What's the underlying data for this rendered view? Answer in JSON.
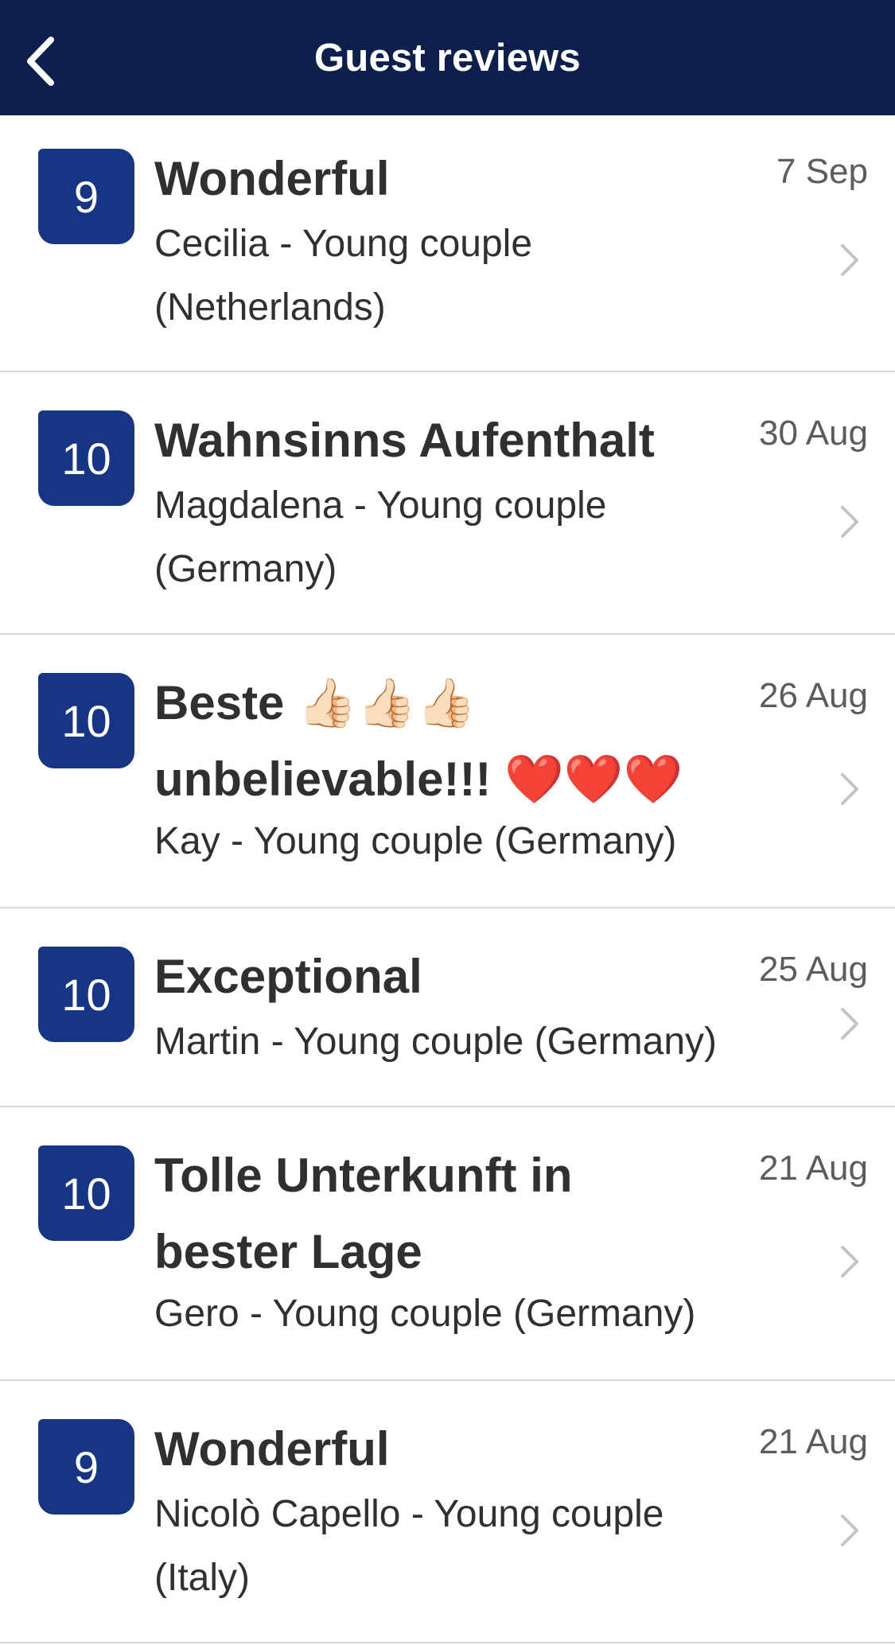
{
  "header": {
    "title": "Guest reviews",
    "back_icon": "chevron-left-icon"
  },
  "colors": {
    "header_bg": "#0c1f4d",
    "score_bg": "#173585",
    "divider": "#d7d7d7",
    "chevron": "#c4c4c7"
  },
  "reviews": [
    {
      "score": "9",
      "title": "Wonderful",
      "reviewer_line1": "Cecilia - Young couple",
      "reviewer_line2": "(Netherlands)",
      "date": "7 Sep"
    },
    {
      "score": "10",
      "title": "Wahnsinns Aufenthalt",
      "reviewer_line1": "Magdalena - Young couple",
      "reviewer_line2": "(Germany)",
      "date": "30 Aug"
    },
    {
      "score": "10",
      "title_line1": "Beste 👍🏻👍🏻👍🏻",
      "title_line2": "unbelievable!!! ❤️❤️❤️",
      "reviewer": "Kay - Young couple (Germany)",
      "date": "26 Aug"
    },
    {
      "score": "10",
      "title": "Exceptional",
      "reviewer": "Martin - Young couple (Germany)",
      "date": "25 Aug"
    },
    {
      "score": "10",
      "title_line1": "Tolle Unterkunft in",
      "title_line2": "bester Lage",
      "reviewer": "Gero - Young couple (Germany)",
      "date": "21 Aug"
    },
    {
      "score": "9",
      "title": "Wonderful",
      "reviewer_line1": "Nicolò Capello - Young couple",
      "reviewer_line2": "(Italy)",
      "date": "21 Aug"
    }
  ]
}
